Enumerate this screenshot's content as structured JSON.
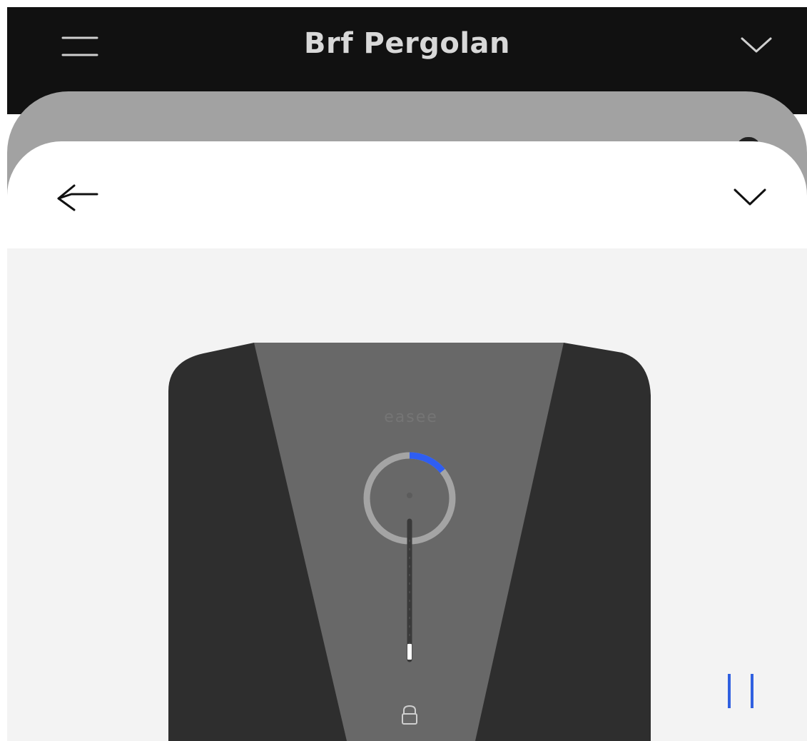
{
  "header": {
    "title": "Brf Pergolan",
    "menu_icon": "hamburger-menu-icon",
    "dropdown_icon": "chevron-down-icon"
  },
  "sheet": {
    "back_icon": "back-arrow-icon",
    "collapse_icon": "chevron-down-icon"
  },
  "device": {
    "brand": "easee",
    "charging_progress": 0.14,
    "status_ring_color": "#2f5ef2",
    "lock_icon": "padlock-icon"
  },
  "controls": {
    "pause_icon": "pause-icon",
    "pause_color": "#3060e0"
  },
  "colors": {
    "header_bg": "#111111",
    "sheet_bg": "#ffffff",
    "device_area_bg": "#f3f3f3",
    "charger_body": "#2e2e2e",
    "charger_front": "#686868"
  }
}
